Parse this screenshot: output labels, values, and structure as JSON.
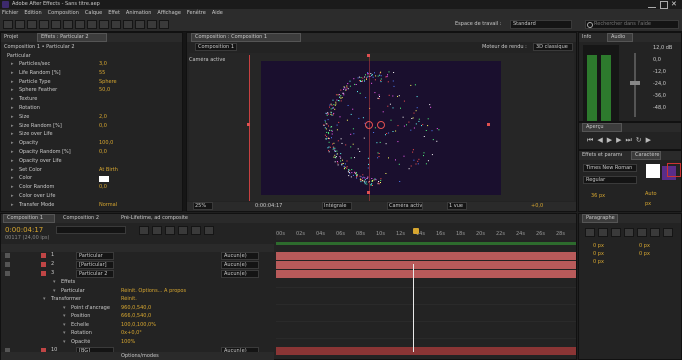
{
  "titlebar": {
    "title": "Adobe After Effects - Sans titre.aep"
  },
  "menu": [
    "Fichier",
    "Edition",
    "Composition",
    "Calque",
    "Effet",
    "Animation",
    "Affichage",
    "Fenêtre",
    "Aide"
  ],
  "toolbar": {
    "workspace_label": "Espace de travail :",
    "workspace_value": "Standard",
    "search_placeholder": "Rechercher dans l'aide"
  },
  "left": {
    "tab_project": "Projet",
    "tab_effects": "Effets : Particular 2",
    "header": "Composition 1 • Particular 2",
    "effect_name": "Particular",
    "props": [
      {
        "label": "Particles/sec",
        "value": "3,0"
      },
      {
        "label": "Life Random [%]",
        "value": "55"
      },
      {
        "label": "Particle Type",
        "value": "Sphere"
      },
      {
        "label": "Sphere Feather",
        "value": "50,0"
      },
      {
        "label": "Texture",
        "value": ""
      },
      {
        "label": "Rotation",
        "value": ""
      },
      {
        "label": "Size",
        "value": "2,0"
      },
      {
        "label": "Size Random [%]",
        "value": "0,0"
      },
      {
        "label": "Size over Life",
        "value": ""
      },
      {
        "label": "Opacity",
        "value": "100,0"
      },
      {
        "label": "Opacity Random [%]",
        "value": "0,0"
      },
      {
        "label": "Opacity over Life",
        "value": ""
      },
      {
        "label": "Set Color",
        "value": "At Birth"
      },
      {
        "label": "Color",
        "value": ""
      },
      {
        "label": "Color Random",
        "value": "0,0"
      },
      {
        "label": "Color over Life",
        "value": ""
      },
      {
        "label": "Transfer Mode",
        "value": "Normal"
      }
    ]
  },
  "viewer": {
    "tab": "Composition : Composition 1",
    "sub_tab": "Composition 1",
    "renderer": "Moteur de rendu :",
    "renderer_value": "3D classique",
    "camera_label": "Caméra active",
    "zoom": "25%",
    "timecode": "0:00:04:17",
    "quality": "Intégrale",
    "view": "Caméra active",
    "views": "1 vue",
    "offset": "+0,0"
  },
  "right": {
    "tab_info": "Info",
    "tab_audio": "Audio",
    "db_labels": [
      "12,0 dB",
      "0,0",
      "-12,0",
      "-24,0",
      "-36,0",
      "-48,0"
    ],
    "preview_tab": "Aperçu",
    "char_tab": "Paragraphe",
    "effects_tab": "Effets et paramètres prédéfinis",
    "font_value": "Times New Roman",
    "style_value": "Regular",
    "para_values": [
      "0 px",
      "0 px",
      "0 px",
      "0 px",
      "0 px"
    ],
    "auto_label": "Auto",
    "px_label": "px"
  },
  "timeline": {
    "tabs": [
      "Composition 1",
      "Composition 2",
      "Pré-Lifetime, ad composite"
    ],
    "timecode": "0:00:04:17",
    "fps": "00117 (24,00 ips)",
    "ruler": [
      "00s",
      "02s",
      "04s",
      "06s",
      "08s",
      "10s",
      "12s",
      "14s",
      "16s",
      "18s",
      "20s",
      "22s",
      "24s",
      "26s",
      "28s"
    ],
    "layers": [
      {
        "num": "1",
        "name": "Particular",
        "mode": "Aucun(e)"
      },
      {
        "num": "2",
        "name": "[Particular]",
        "mode": "Aucun(e)"
      },
      {
        "num": "3",
        "name": "Particular 2",
        "mode": "Aucun(e)"
      }
    ],
    "subprops": [
      {
        "label": "Effets",
        "value": ""
      },
      {
        "label": "Particular",
        "value": "Réinit.  Options...  À propos"
      },
      {
        "label": "Transformer",
        "value": "Réinit."
      },
      {
        "label": "Point d'ancrage",
        "value": "960,0,540,0"
      },
      {
        "label": "Position",
        "value": "666,0,540,0"
      },
      {
        "label": "Échelle",
        "value": "100,0,100,0%"
      },
      {
        "label": "Rotation",
        "value": "0x+0,0°"
      },
      {
        "label": "Opacité",
        "value": "100%"
      }
    ],
    "last_layer": {
      "num": "10",
      "name": "[BG]",
      "mode": "Aucun(e)"
    },
    "footer": "Options/modes"
  },
  "colors": {
    "accent": "#d6a630",
    "comp_bg": "#1a0f2e",
    "layer_bar": "#b85a5a",
    "timeline_bar": "#8a3535"
  }
}
